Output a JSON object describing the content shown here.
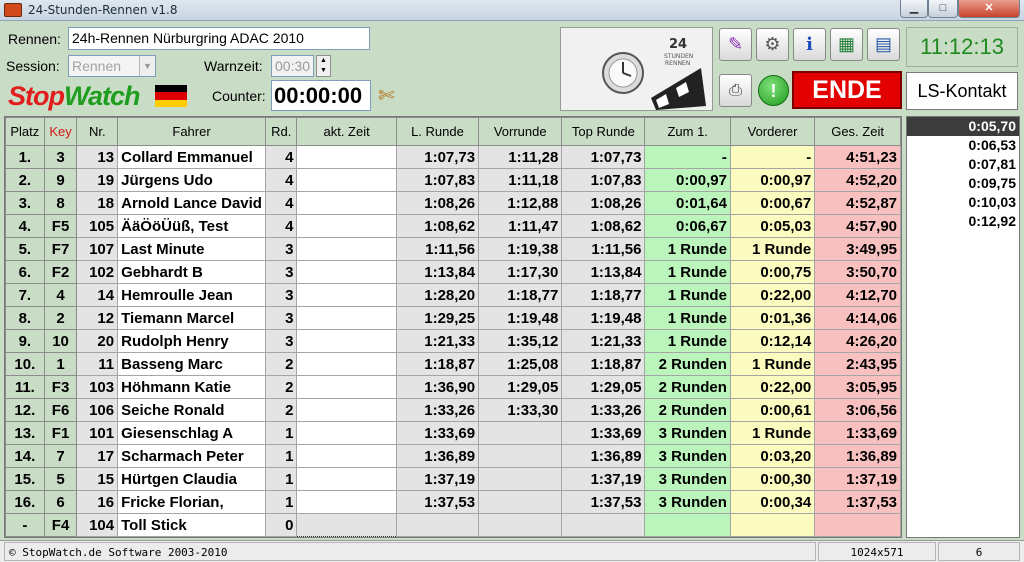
{
  "window": {
    "title": "24-Stunden-Rennen v1.8",
    "min": "▁",
    "max": "□",
    "close": "✕"
  },
  "form": {
    "rennen_label": "Rennen:",
    "rennen_value": "24h-Rennen Nürburgring ADAC 2010",
    "session_label": "Session:",
    "session_value": "Rennen",
    "warnzeit_label": "Warnzeit:",
    "warnzeit_value": "00:30",
    "counter_label": "Counter:",
    "counter_value": "00:00:00"
  },
  "logo": {
    "stop": "Stop",
    "watch": "Watch"
  },
  "flag_colors": [
    "#000000",
    "#dd0000",
    "#ffcc00"
  ],
  "toolbar": {
    "help_icon": "book-icon",
    "settings_icon": "gears-icon",
    "info_icon": "info-icon",
    "excel_icon": "excel-icon",
    "export_icon": "document-icon",
    "print_icon": "print-icon",
    "start_label": "!",
    "ende_label": "ENDE"
  },
  "clock": "11:12:13",
  "ls_kontakt": "LS-Kontakt",
  "table": {
    "columns": [
      "Platz",
      "Key",
      "Nr.",
      "Fahrer",
      "Rd.",
      "akt. Zeit",
      "L. Runde",
      "Vorrunde",
      "Top Runde",
      "Zum 1.",
      "Vorderer",
      "Ges. Zeit"
    ],
    "rows": [
      [
        "1.",
        "3",
        "13",
        "Collard Emmanuel",
        "4",
        "",
        "1:07,73",
        "1:11,28",
        "1:07,73",
        "-",
        "-",
        "4:51,23"
      ],
      [
        "2.",
        "9",
        "19",
        "Jürgens Udo",
        "4",
        "",
        "1:07,83",
        "1:11,18",
        "1:07,83",
        "0:00,97",
        "0:00,97",
        "4:52,20"
      ],
      [
        "3.",
        "8",
        "18",
        "Arnold Lance David",
        "4",
        "",
        "1:08,26",
        "1:12,88",
        "1:08,26",
        "0:01,64",
        "0:00,67",
        "4:52,87"
      ],
      [
        "4.",
        "F5",
        "105",
        "ÄäÖöÜüß, Test",
        "4",
        "",
        "1:08,62",
        "1:11,47",
        "1:08,62",
        "0:06,67",
        "0:05,03",
        "4:57,90"
      ],
      [
        "5.",
        "F7",
        "107",
        "Last Minute",
        "3",
        "",
        "1:11,56",
        "1:19,38",
        "1:11,56",
        "1 Runde",
        "1 Runde",
        "3:49,95"
      ],
      [
        "6.",
        "F2",
        "102",
        "Gebhardt B",
        "3",
        "",
        "1:13,84",
        "1:17,30",
        "1:13,84",
        "1 Runde",
        "0:00,75",
        "3:50,70"
      ],
      [
        "7.",
        "4",
        "14",
        "Hemroulle Jean",
        "3",
        "",
        "1:28,20",
        "1:18,77",
        "1:18,77",
        "1 Runde",
        "0:22,00",
        "4:12,70"
      ],
      [
        "8.",
        "2",
        "12",
        "Tiemann Marcel",
        "3",
        "",
        "1:29,25",
        "1:19,48",
        "1:19,48",
        "1 Runde",
        "0:01,36",
        "4:14,06"
      ],
      [
        "9.",
        "10",
        "20",
        "Rudolph Henry",
        "3",
        "",
        "1:21,33",
        "1:35,12",
        "1:21,33",
        "1 Runde",
        "0:12,14",
        "4:26,20"
      ],
      [
        "10.",
        "1",
        "11",
        "Basseng Marc",
        "2",
        "",
        "1:18,87",
        "1:25,08",
        "1:18,87",
        "2 Runden",
        "1 Runde",
        "2:43,95"
      ],
      [
        "11.",
        "F3",
        "103",
        "Höhmann Katie",
        "2",
        "",
        "1:36,90",
        "1:29,05",
        "1:29,05",
        "2 Runden",
        "0:22,00",
        "3:05,95"
      ],
      [
        "12.",
        "F6",
        "106",
        "Seiche Ronald",
        "2",
        "",
        "1:33,26",
        "1:33,30",
        "1:33,26",
        "2 Runden",
        "0:00,61",
        "3:06,56"
      ],
      [
        "13.",
        "F1",
        "101",
        "Giesenschlag A",
        "1",
        "",
        "1:33,69",
        "",
        "1:33,69",
        "3 Runden",
        "1 Runde",
        "1:33,69"
      ],
      [
        "14.",
        "7",
        "17",
        "Scharmach Peter",
        "1",
        "",
        "1:36,89",
        "",
        "1:36,89",
        "3 Runden",
        "0:03,20",
        "1:36,89"
      ],
      [
        "15.",
        "5",
        "15",
        "Hürtgen Claudia",
        "1",
        "",
        "1:37,19",
        "",
        "1:37,19",
        "3 Runden",
        "0:00,30",
        "1:37,19"
      ],
      [
        "16.",
        "6",
        "16",
        "Fricke Florian,",
        "1",
        "",
        "1:37,53",
        "",
        "1:37,53",
        "3 Runden",
        "0:00,34",
        "1:37,53"
      ],
      [
        "-",
        "F4",
        "104",
        "Toll Stick",
        "0",
        "",
        "",
        "",
        "",
        "",
        "",
        ""
      ]
    ]
  },
  "splits": [
    "0:05,70",
    "0:06,53",
    "0:07,81",
    "0:09,75",
    "0:10,03",
    "0:12,92"
  ],
  "status": {
    "copyright": "© StopWatch.de Software 2003-2010",
    "resolution": "1024x571",
    "count": "6"
  }
}
